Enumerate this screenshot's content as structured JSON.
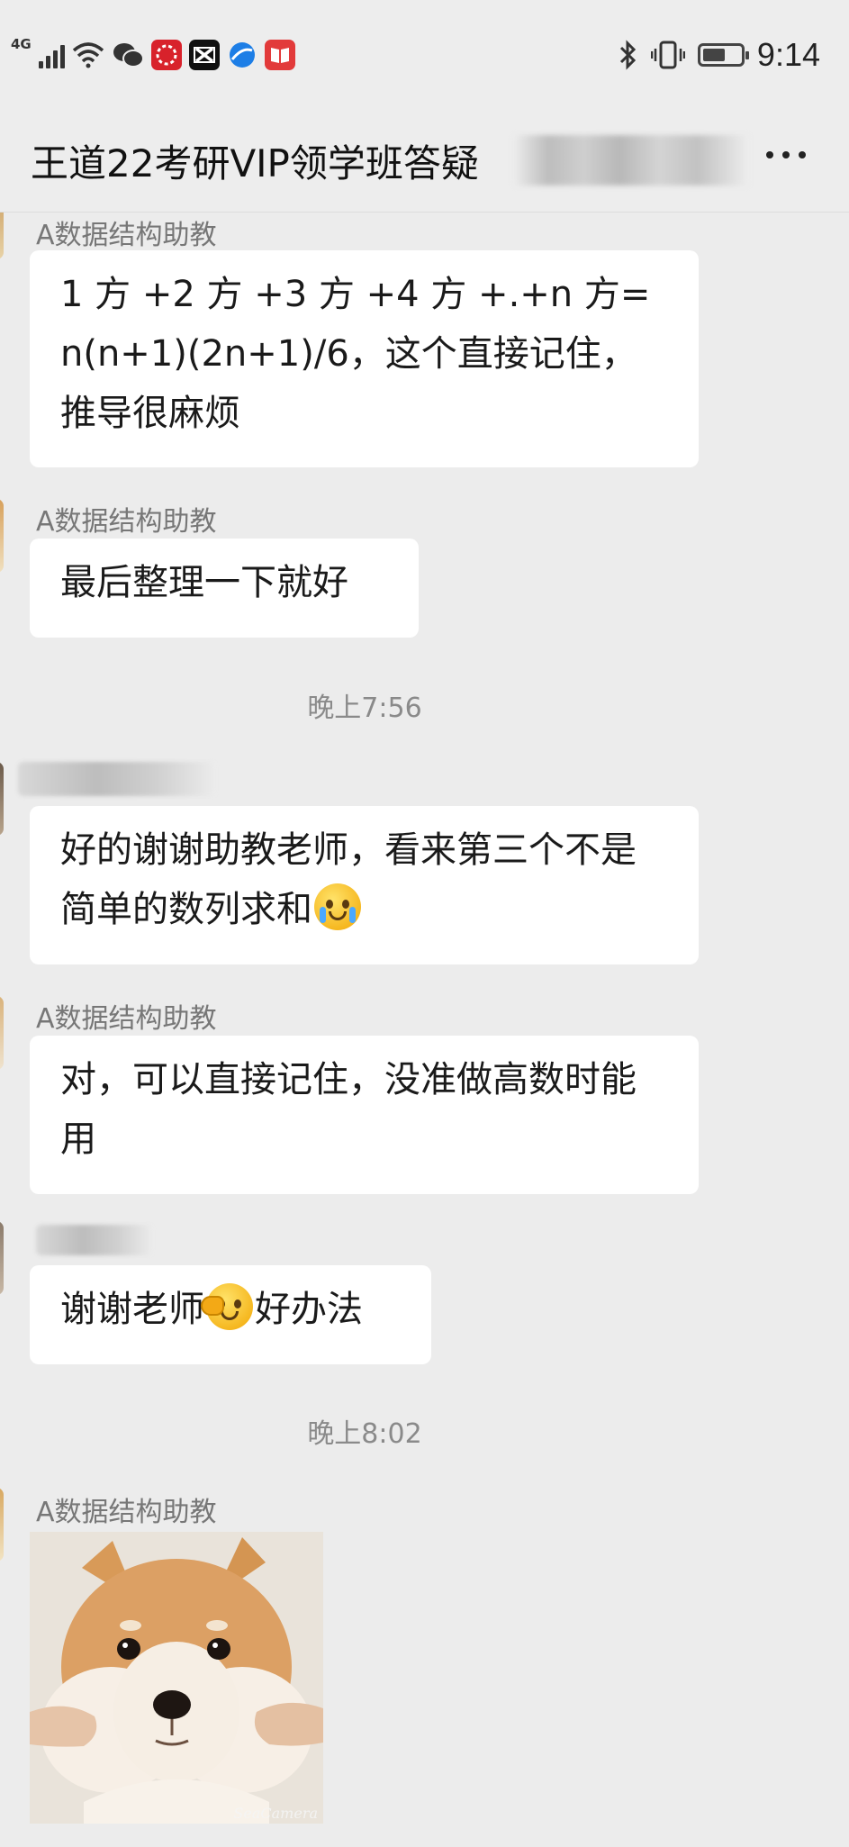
{
  "status_bar": {
    "network": "4G",
    "time": "9:14",
    "battery_level": 0.6,
    "icons": [
      "signal-icon",
      "wifi-icon",
      "wechat-icon",
      "red-app-icon",
      "capcut-icon",
      "browser-icon",
      "book-app-icon",
      "bluetooth-icon",
      "vibrate-icon",
      "battery-icon"
    ]
  },
  "header": {
    "title": "王道22考研VIP领学班答疑",
    "more_icon": "more-dots-icon"
  },
  "messages": [
    {
      "sender": "A数据结构助教",
      "text": "1 方 +2 方 +3 方 +4 方 +.+n 方=n(n+1)(2n+1)/6，这个直接记住，推导很麻烦"
    },
    {
      "sender": "A数据结构助教",
      "text": "最后整理一下就好"
    },
    {
      "timestamp": "晚上7:56"
    },
    {
      "sender": "",
      "text_before_emoji": "好的谢谢助教老师，看来第三个不是简单的数列求和",
      "emoji": "crying-face-icon"
    },
    {
      "sender": "A数据结构助教",
      "text": "对，可以直接记住，没准做高数时能用"
    },
    {
      "sender": "",
      "text_before_emoji": "谢谢老师",
      "emoji": "face-palm-icon",
      "text_after_emoji": "好办法"
    },
    {
      "timestamp": "晚上8:02"
    },
    {
      "sender": "A数据结构助教",
      "sticker": "shiba-dog-sticker",
      "watermark": "SeaCamera"
    }
  ],
  "colors": {
    "background": "#ececec",
    "bubble": "#ffffff",
    "title_bar": "#ededed",
    "sender_text": "#777777",
    "timestamp_text": "#8a8a8a"
  }
}
